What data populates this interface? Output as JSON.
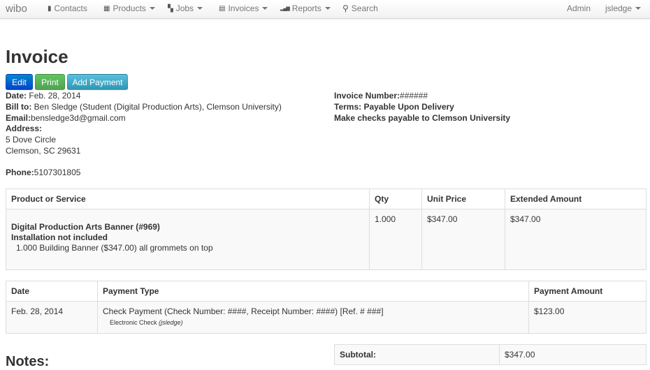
{
  "navbar": {
    "brand": "wibo",
    "items": [
      {
        "label": "Contacts",
        "icon": "book-icon",
        "glyph": "▮",
        "dropdown": false
      },
      {
        "label": "Products",
        "icon": "grid-icon",
        "glyph": "▦",
        "dropdown": true
      },
      {
        "label": "Jobs",
        "icon": "blocks-icon",
        "glyph": "▚",
        "dropdown": true
      },
      {
        "label": "Invoices",
        "icon": "list-icon",
        "glyph": "▤",
        "dropdown": true
      },
      {
        "label": "Reports",
        "icon": "signal-icon",
        "glyph": "▂▄▆",
        "dropdown": true
      },
      {
        "label": "Search",
        "icon": "search-icon",
        "glyph": "⚲",
        "dropdown": false
      }
    ],
    "admin": "Admin",
    "user": "jsledge"
  },
  "page": {
    "title": "Invoice",
    "buttons": {
      "edit": "Edit",
      "print": "Print",
      "add_payment": "Add Payment"
    }
  },
  "invoice": {
    "date_label": "Date:",
    "date": "Feb. 28, 2014",
    "bill_to_label": "Bill to:",
    "bill_to": "Ben Sledge (Student (Digital Production Arts), Clemson University)",
    "email_label": "Email:",
    "email": "bensledge3d@gmail.com",
    "address_label": "Address:",
    "address_line1": "5 Dove Circle",
    "address_line2": "Clemson, SC 29631",
    "phone_label": "Phone:",
    "phone": "5107301805",
    "number_label": "Invoice Number:",
    "number": "######",
    "terms": "Terms: Payable Upon Delivery",
    "payable_to": "Make checks payable to Clemson University"
  },
  "items_table": {
    "headers": {
      "product": "Product or Service",
      "qty": "Qty",
      "unit_price": "Unit Price",
      "extended": "Extended Amount"
    },
    "row": {
      "product_name": "Digital Production Arts Banner (#969)",
      "note": "Installation not included",
      "line": "1.000 Building Banner ($347.00) all grommets on top",
      "qty": "1.000",
      "unit_price": "$347.00",
      "extended": "$347.00"
    }
  },
  "payments_table": {
    "headers": {
      "date": "Date",
      "type": "Payment Type",
      "amount": "Payment Amount"
    },
    "row": {
      "date": "Feb. 28, 2014",
      "type": "Check Payment (Check Number: ####, Receipt Number: ####) [Ref. # ###]",
      "sub_prefix": "Electronic Check",
      "sub_user": "(jsledge)",
      "amount": "$123.00"
    }
  },
  "notes_heading": "Notes:",
  "totals": {
    "subtotal_label": "Subtotal:",
    "subtotal": "$347.00"
  }
}
